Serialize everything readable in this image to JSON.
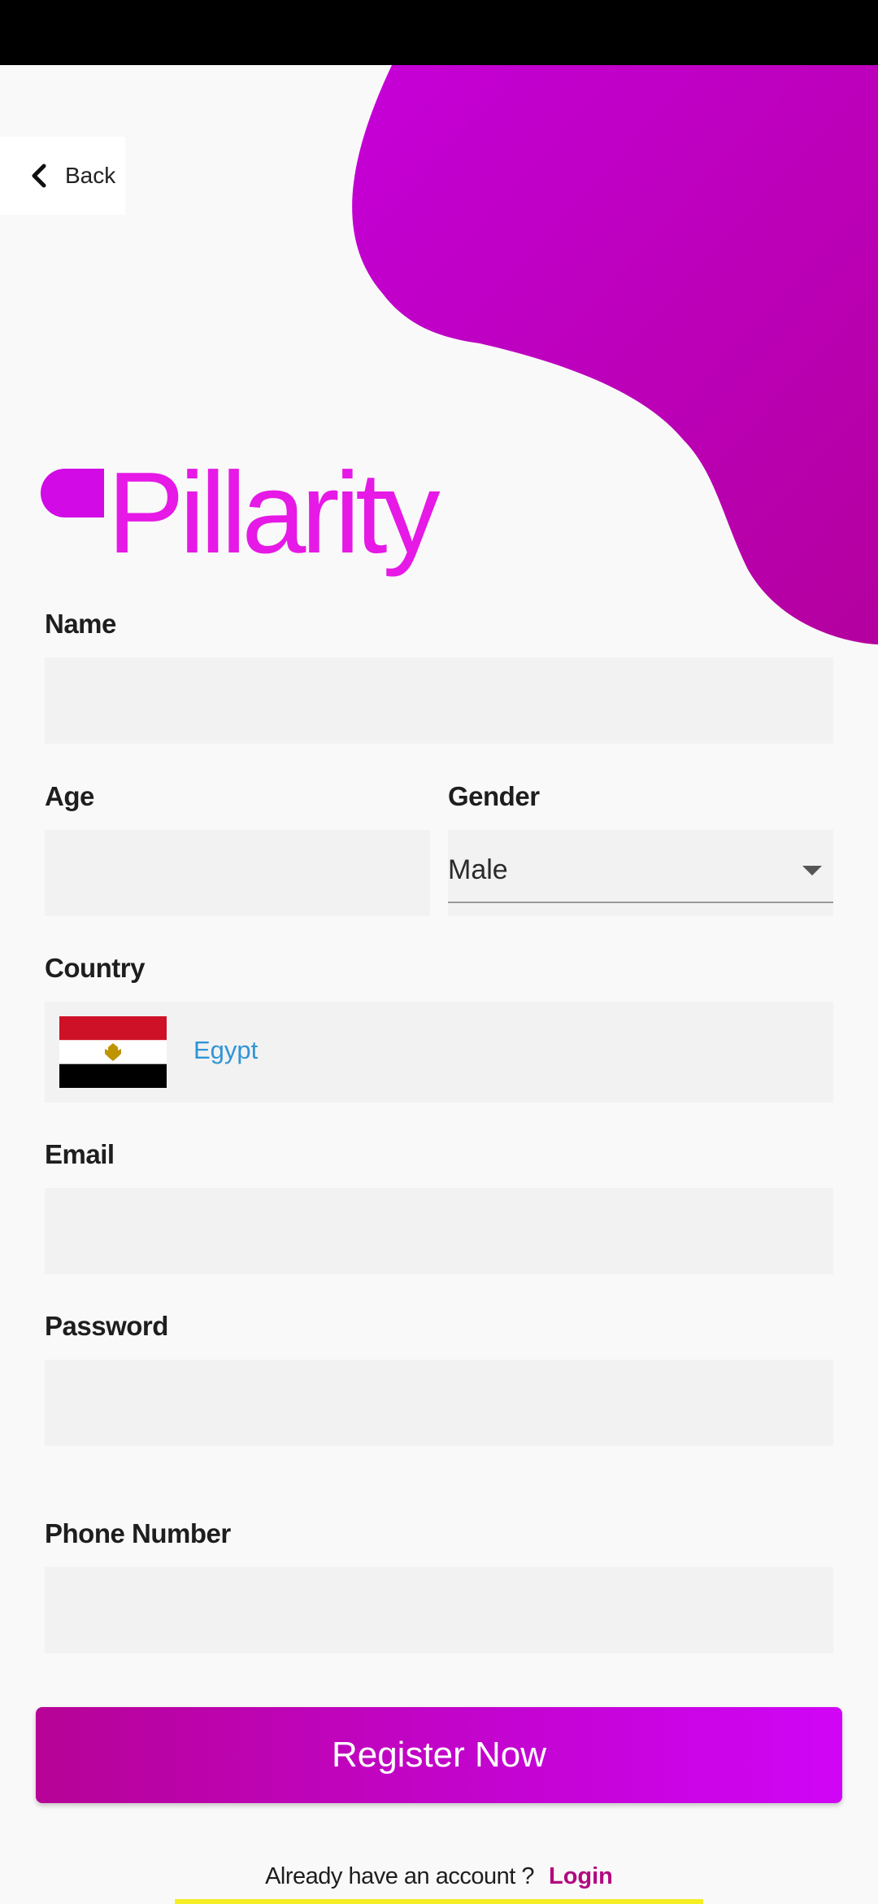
{
  "header": {
    "back_label": "Back"
  },
  "brand": {
    "name": "Pillarity",
    "accent_color": "#e619e6",
    "blob_color": "#c000c8"
  },
  "form": {
    "name": {
      "label": "Name",
      "value": ""
    },
    "age": {
      "label": "Age",
      "value": ""
    },
    "gender": {
      "label": "Gender",
      "selected": "Male"
    },
    "country": {
      "label": "Country",
      "value": "Egypt",
      "flag": "egypt-flag"
    },
    "email": {
      "label": "Email",
      "value": ""
    },
    "password": {
      "label": "Password",
      "value": ""
    },
    "phone": {
      "label": "Phone Number",
      "value": ""
    }
  },
  "actions": {
    "register_label": "Register Now",
    "account_question": "Already have an account ?",
    "login_label": "Login"
  }
}
